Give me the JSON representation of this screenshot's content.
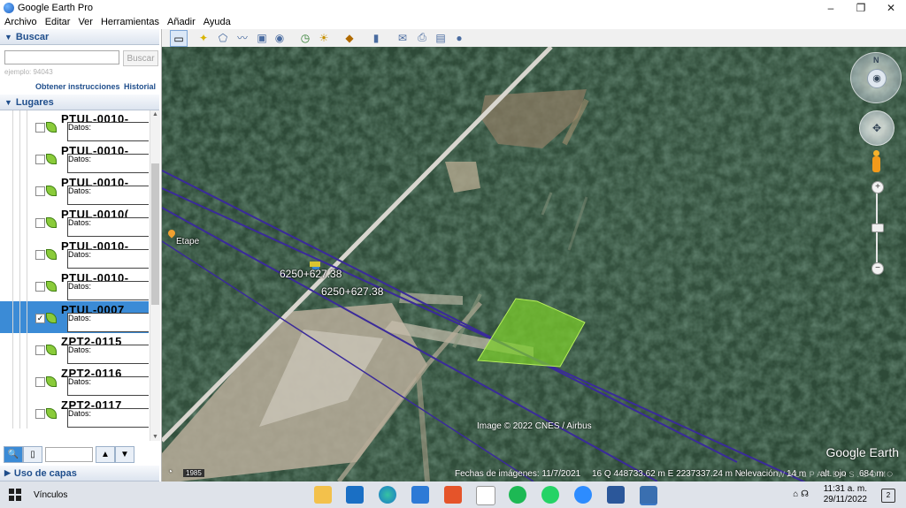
{
  "window": {
    "title": "Google Earth Pro",
    "controls": [
      "–",
      "❐",
      "✕"
    ]
  },
  "menu": [
    "Archivo",
    "Editar",
    "Ver",
    "Herramientas",
    "Añadir",
    "Ayuda"
  ],
  "search": {
    "header": "Buscar",
    "button": "Buscar",
    "hint": "ejemplo: 94043",
    "link_directions": "Obtener instrucciones",
    "link_history": "Historial"
  },
  "places": {
    "header": "Lugares",
    "items": [
      {
        "name": "PTUL-0010-",
        "sub": "Datos:",
        "checked": false,
        "selected": false
      },
      {
        "name": "PTUL-0010-",
        "sub": "Datos:",
        "checked": false,
        "selected": false
      },
      {
        "name": "PTUL-0010-",
        "sub": "Datos:",
        "checked": false,
        "selected": false
      },
      {
        "name": "PTUL-0010(",
        "sub": "Datos:",
        "checked": false,
        "selected": false
      },
      {
        "name": "PTUL-0010-",
        "sub": "Datos:",
        "checked": false,
        "selected": false
      },
      {
        "name": "PTUL-0010-",
        "sub": "Datos:",
        "checked": false,
        "selected": false
      },
      {
        "name": "PTUL-0007",
        "sub": "Datos:",
        "checked": true,
        "selected": true
      },
      {
        "name": "ZPT2-0115",
        "sub": "Datos:",
        "checked": false,
        "selected": false
      },
      {
        "name": "ZPT2-0116",
        "sub": "Datos:",
        "checked": false,
        "selected": false
      },
      {
        "name": "ZPT2-0117",
        "sub": "Datos:",
        "checked": false,
        "selected": false
      }
    ]
  },
  "layers": {
    "header": "Uso de capas"
  },
  "map": {
    "label_etape": "Etape",
    "label_1": "6250+627.38",
    "label_2": "6250+627.38",
    "copyright": "Image © 2022 CNES / Airbus",
    "brand": "Google Earth",
    "watermark": "WALLPAPERS.COM",
    "year": "1985",
    "status": {
      "imagery_date": "Fechas de imágenes: 11/7/2021",
      "coords": "16 Q 448733.62 m E 2237337.24 m N",
      "elevation_label": "elevación",
      "elevation": "14 m",
      "eye_label": "alt. ojo",
      "eye": "684 m"
    }
  },
  "taskbar": {
    "text": "Vínculos",
    "time": "11:31 a. m.",
    "date": "29/11/2022",
    "notifications": "2"
  },
  "colors": {
    "accent": "#3b8bd6",
    "polygon": "#7ccf2a",
    "route": "#3a2a9a"
  }
}
